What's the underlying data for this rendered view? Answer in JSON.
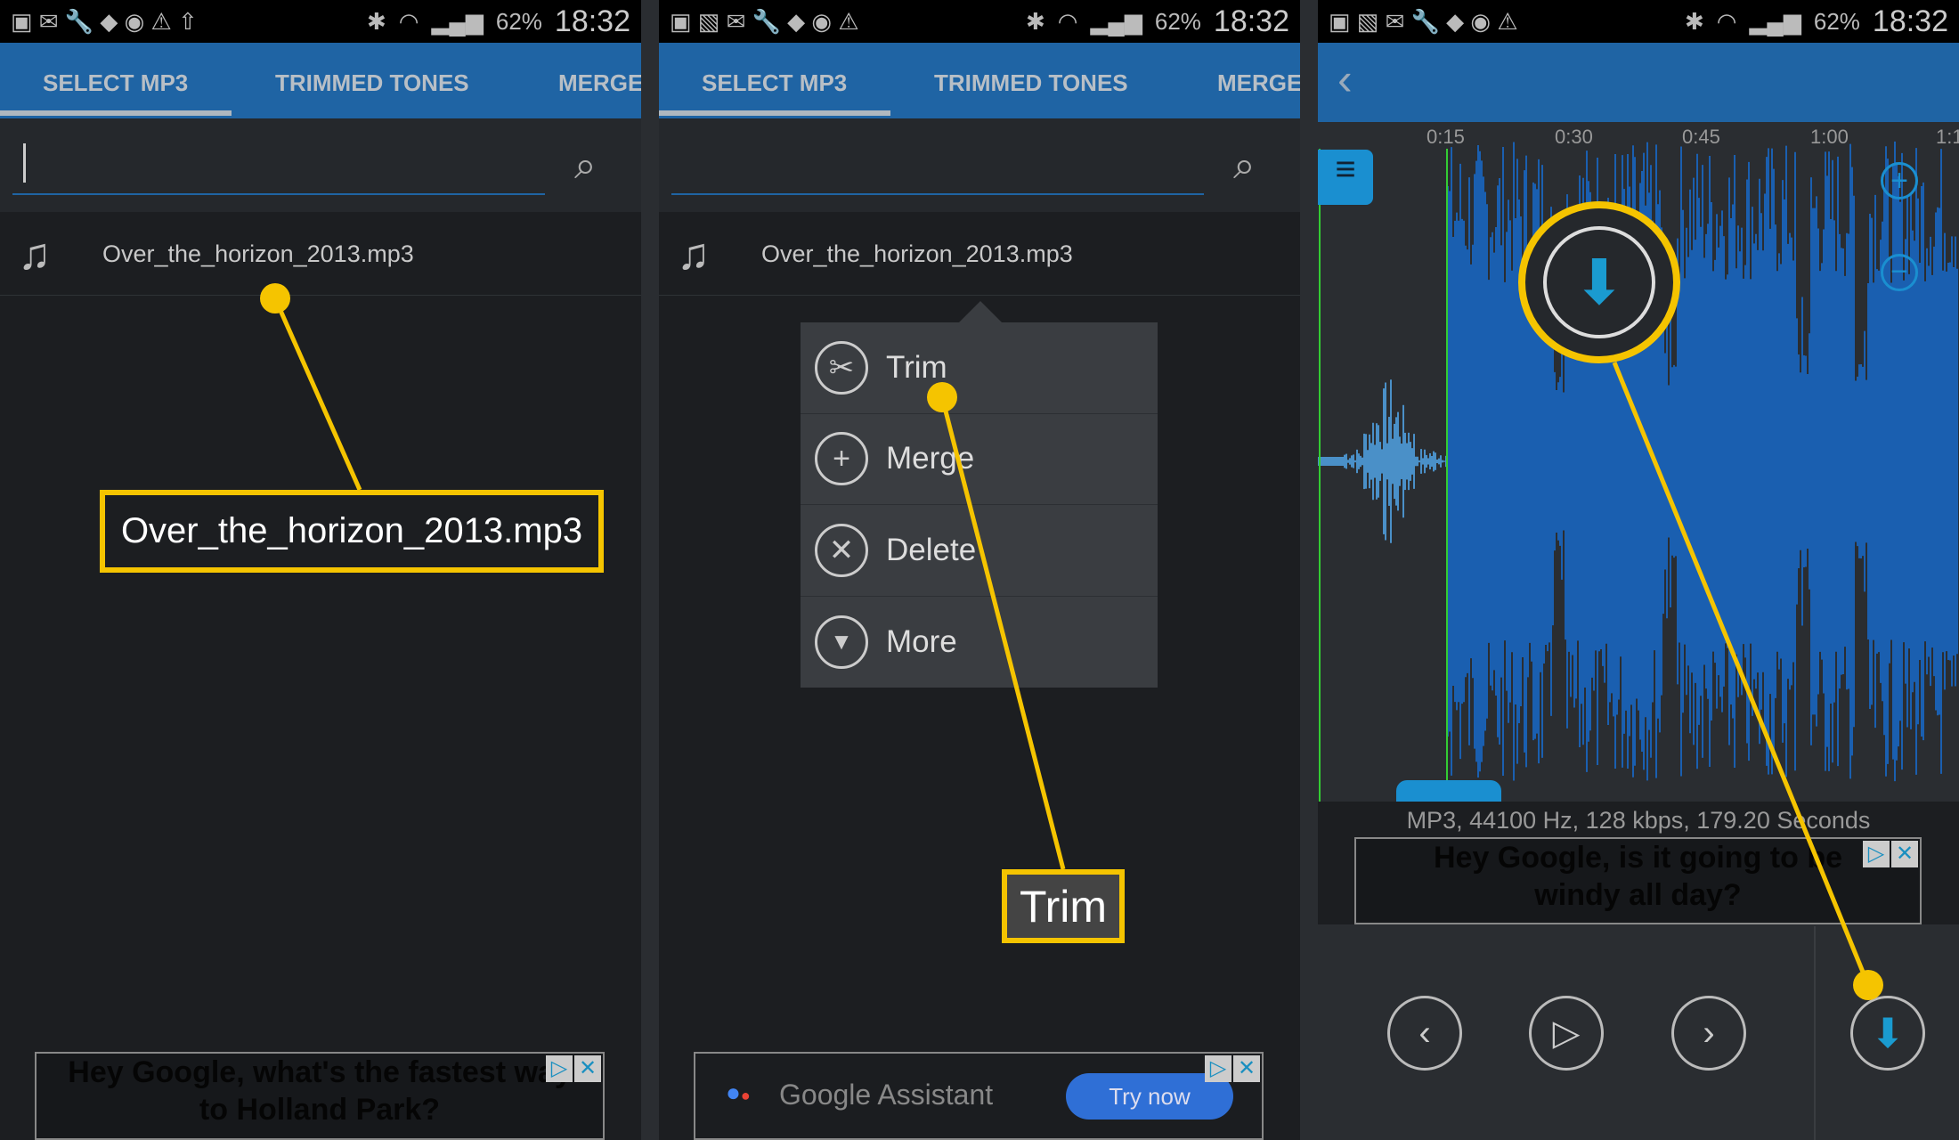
{
  "status": {
    "battery": "62%",
    "time": "18:32"
  },
  "tabs": [
    {
      "label": "SELECT MP3",
      "active": true
    },
    {
      "label": "TRIMMED TONES"
    },
    {
      "label": "MERGE"
    }
  ],
  "panel1": {
    "file": "Over_the_horizon_2013.mp3",
    "callout": "Over_the_horizon_2013.mp3",
    "ad": {
      "line1": "Hey Google, what's the fastest way",
      "line2": "to Holland Park?"
    }
  },
  "panel2": {
    "file": "Over_the_horizon_2013.mp3",
    "menu": [
      {
        "label": "Trim",
        "icon": "scissors-icon"
      },
      {
        "label": "Merge",
        "icon": "plus-icon"
      },
      {
        "label": "Delete",
        "icon": "x-icon"
      },
      {
        "label": "More",
        "icon": "dropdown-icon"
      }
    ],
    "callout": "Trim",
    "ad": {
      "brand": "Google Assistant",
      "button": "Try now"
    }
  },
  "panel3": {
    "timeline": [
      "0:15",
      "0:30",
      "0:45",
      "1:00",
      "1:1"
    ],
    "info": "MP3, 44100 Hz, 128 kbps, 179.20 Seconds",
    "ad": {
      "line1": "Hey Google, is it going to be",
      "line2": "windy all day?"
    }
  },
  "colors": {
    "accent": "#1f64a4",
    "highlight": "#f5c400",
    "waveform": "#1a5fb0",
    "download": "#1a9bd0"
  }
}
